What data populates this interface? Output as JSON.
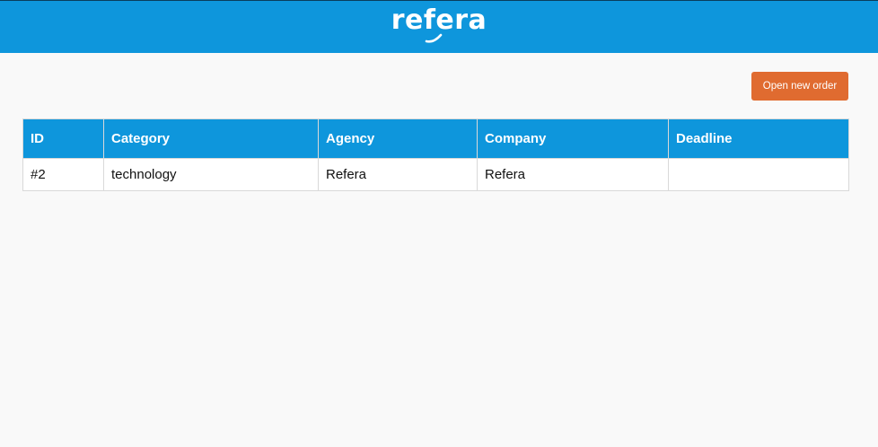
{
  "header": {
    "logo_text": "refera",
    "background_color": "#0e96dc"
  },
  "actions": {
    "open_new_order_label": "Open new order",
    "button_color": "#e06b30"
  },
  "table": {
    "columns": [
      "ID",
      "Category",
      "Agency",
      "Company",
      "Deadline"
    ],
    "rows": [
      {
        "id": "#2",
        "category": "technology",
        "agency": "Refera",
        "company": "Refera",
        "deadline": ""
      }
    ]
  }
}
